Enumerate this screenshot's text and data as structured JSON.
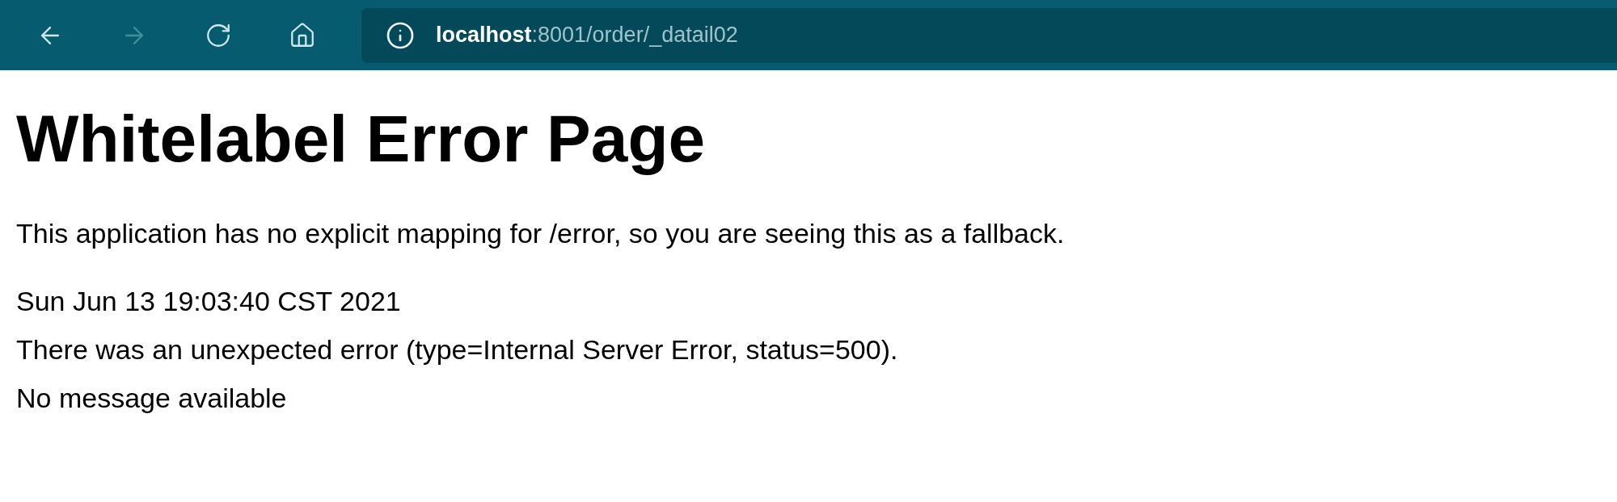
{
  "toolbar": {
    "buttons": [
      {
        "kind": "back",
        "disabled": false
      },
      {
        "kind": "forward",
        "disabled": true
      },
      {
        "kind": "reload",
        "disabled": false
      },
      {
        "kind": "home",
        "disabled": false
      }
    ],
    "address": {
      "host": "localhost",
      "path": ":8001/order/_datail02"
    }
  },
  "page": {
    "heading": "Whitelabel Error Page",
    "paragraph": "This application has no explicit mapping for /error, so you are seeing this as a fallback.",
    "lines": [
      "Sun Jun 13 19:03:40 CST 2021",
      "There was an unexpected error (type=Internal Server Error, status=500).",
      "No message available"
    ]
  }
}
